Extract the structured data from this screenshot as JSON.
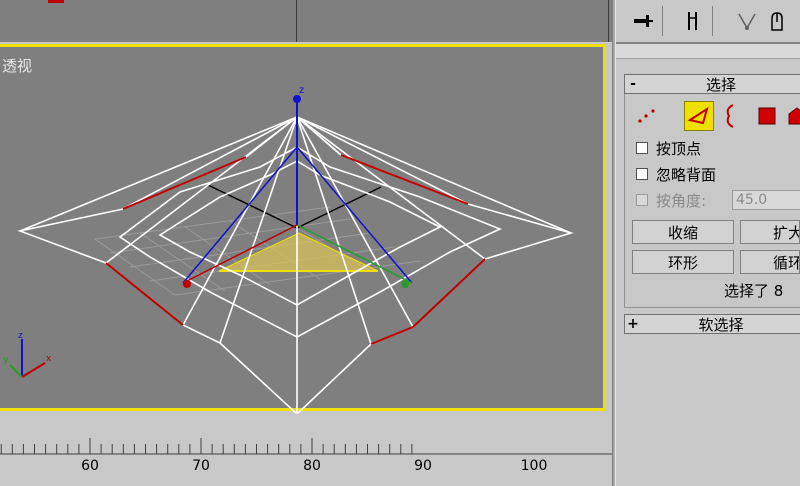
{
  "viewport": {
    "label": "透视"
  },
  "axes": {
    "z": "z",
    "y": "y",
    "x": "x"
  },
  "gizmo": {
    "z_label": "z"
  },
  "timeline": {
    "ticks": [
      "60",
      "70",
      "80",
      "90",
      "100"
    ]
  },
  "command_panel": {
    "tabs": [
      "pin-icon",
      "hierarchy-icon",
      "motion-icon",
      "display-icon"
    ]
  },
  "selection_rollout": {
    "collapse_symbol": "-",
    "title": "选择",
    "subobject_levels": [
      "vertex-icon",
      "edge-icon",
      "border-icon",
      "polygon-icon",
      "element-icon"
    ],
    "options": {
      "by_vertex": "按顶点",
      "ignore_backfacing": "忽略背面",
      "by_angle": "按角度:",
      "angle_value": "45.0"
    },
    "buttons": {
      "shrink": "收缩",
      "grow": "扩大",
      "ring": "环形",
      "loop": "循环"
    },
    "status": "选择了 8"
  },
  "soft_selection_rollout": {
    "expand_symbol": "+",
    "title": "软选择"
  },
  "colors": {
    "viewport_bg": "#7f7f7f",
    "active_border": "#f0e000",
    "mesh": "#ffffff",
    "selected_edge": "#c00000"
  }
}
